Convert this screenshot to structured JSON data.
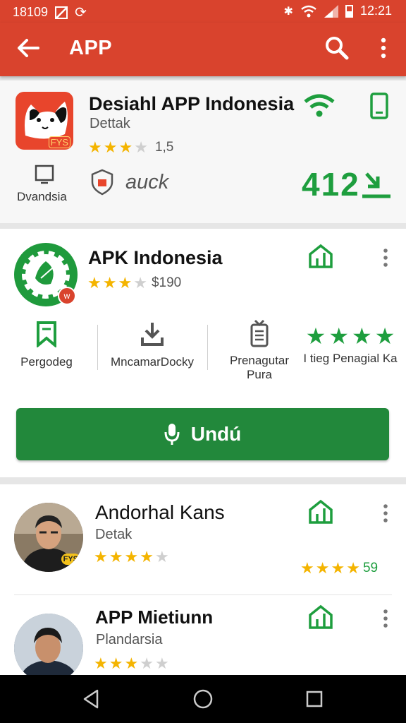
{
  "status_bar": {
    "time": "18109",
    "clock": "12:21"
  },
  "app_bar": {
    "title": "APP"
  },
  "featured": {
    "name": "Desiahl APP Indonesia",
    "subtitle": "Dettak",
    "rating": 3,
    "rating_value": "1,5",
    "logo_text": "FYS",
    "side_label": "Dvandsia",
    "tag_text": "auck",
    "count": "412"
  },
  "apk": {
    "name": "APK Indonesia",
    "rating": 3,
    "price": "$190",
    "metrics": [
      {
        "label": "Pergodeg",
        "icon": "bookmark-icon"
      },
      {
        "label": "MncamarDocky",
        "icon": "download-icon"
      },
      {
        "label": "Prenagutar Pura",
        "icon": "tv-icon"
      },
      {
        "label": "I tieg Penagial Ka",
        "icon": "stars"
      }
    ],
    "install_label": "Undú"
  },
  "people": [
    {
      "name": "Andorhal Kans",
      "subtitle": "Detak",
      "rating": 4,
      "right_rating": 4,
      "right_value": "59",
      "badge": "FYS"
    },
    {
      "name": "APP Mietiunn",
      "subtitle": "Plandarsia",
      "rating": 3
    }
  ],
  "colors": {
    "brand_red": "#d9432d",
    "install_green": "#22883b",
    "star_gold": "#f4b400",
    "accent_green": "#1e9e3e"
  }
}
